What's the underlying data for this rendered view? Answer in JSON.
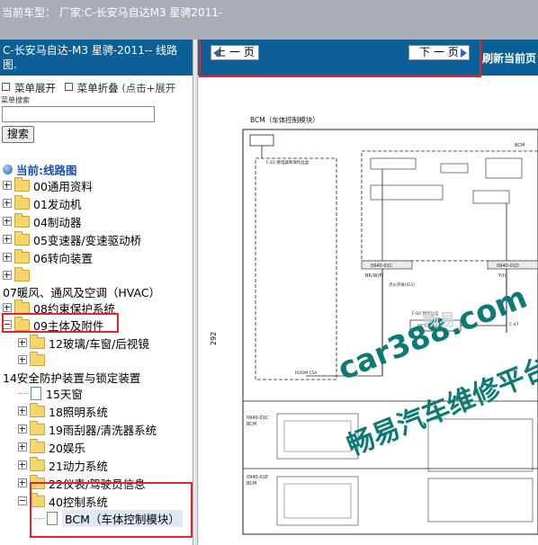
{
  "topbar": {
    "car_label": "当前车型：  厂家:C-长安马自达M3 星骋2011-"
  },
  "sidebar": {
    "title": "C-长安马自达-M3 星骋-2011-- 线路图.",
    "expand_label": "菜单展开",
    "collapse_label": "菜单折叠",
    "hint": "(点击+展开",
    "search_label": "菜单搜索",
    "search_value": "",
    "search_button": "搜索",
    "current_label": "当前:线路图"
  },
  "tree": [
    {
      "label": "00通用资料"
    },
    {
      "label": "01发动机"
    },
    {
      "label": "04制动器"
    },
    {
      "label": "05变速器/变速驱动桥"
    },
    {
      "label": "06转向装置"
    },
    {
      "label": ""
    },
    {
      "label": "07暖风、通风及空调（HVAC）"
    },
    {
      "label": "08约束保护系统"
    },
    {
      "label": "09主体及附件"
    },
    {
      "label": "12玻璃/车窗/后视镜"
    },
    {
      "label": ""
    },
    {
      "label": "14安全防护装置与锁定装置"
    },
    {
      "label": "15天窗"
    },
    {
      "label": "18照明系统"
    },
    {
      "label": "19雨刮器/清洗器系统"
    },
    {
      "label": "20娱乐"
    },
    {
      "label": "21动力系统"
    },
    {
      "label": "22仪表/驾驶员信息"
    },
    {
      "label": "40控制系统"
    },
    {
      "label": "BCM（车体控制模块）"
    }
  ],
  "nav": {
    "prev_label": "上 一 页",
    "next_label": "下 一 页",
    "refresh_label": "刷新当前页"
  },
  "diagram": {
    "title": "BCM（车体控制模块）",
    "page_number": "292",
    "bcm_label": "BCM",
    "fuse_label": "F-01  继电器和保险丝盒",
    "conn1": "0940-01C",
    "conn2": "0940-01D",
    "wire1": "BR/W(F)",
    "wire2": "Y(I)",
    "ignition_label": "点火开关(IG1)",
    "meter": "METER 15A",
    "fuse2": "F-02  保险丝盒",
    "room": "ROOM 15A",
    "c47": "C-47",
    "table1_name": "0940-01C",
    "table1_sub": "BCM",
    "table2_name": "0940-01E",
    "table2_sub": "BCM",
    "watermark_site": "car388.com",
    "watermark_cn": "畅易汽车维修平台",
    "watermark_small": "畅易"
  }
}
